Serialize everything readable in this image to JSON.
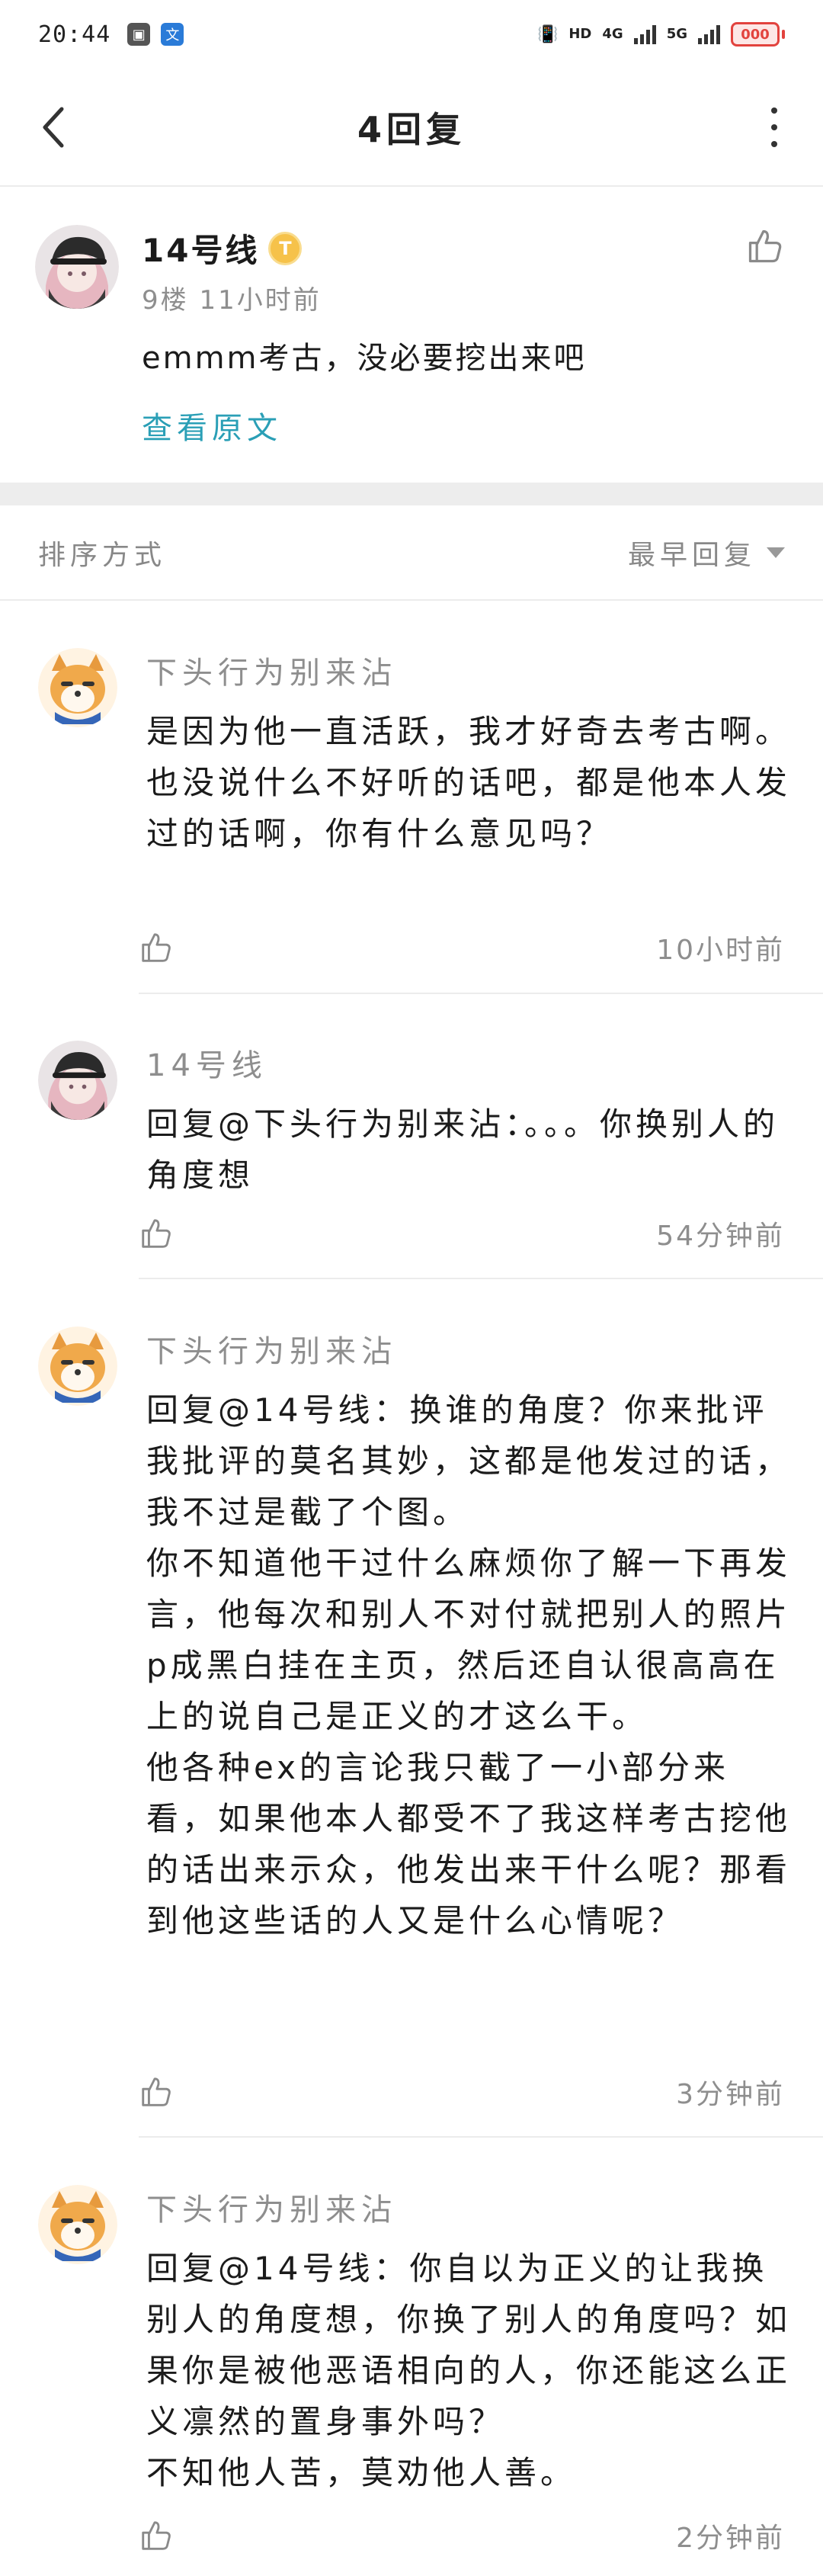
{
  "status_bar": {
    "time": "20:44",
    "network_left": "HD",
    "network_1": "4G",
    "network_2": "5G",
    "battery": "000"
  },
  "header": {
    "title": "4回复"
  },
  "post": {
    "author": "14号线",
    "level": "T",
    "meta": "9楼  11小时前",
    "text": "emmm考古，没必要挖出来吧",
    "view_original": "查看原文"
  },
  "sort": {
    "label": "排序方式",
    "selected": "最早回复"
  },
  "replies": [
    {
      "author": "下头行为别来沾",
      "text": "是因为他一直活跃，我才好奇去考古啊。也没说什么不好听的话吧，都是他本人发过的话啊，你有什么意见吗？",
      "time": "10小时前"
    },
    {
      "author": "14号线",
      "text": "回复@下头行为别来沾：。。。你换别人的角度想",
      "time": "54分钟前"
    },
    {
      "author": "下头行为别来沾",
      "text": "回复@14号线：换谁的角度？你来批评我批评的莫名其妙，这都是他发过的话，我不过是截了个图。\n你不知道他干过什么麻烦你了解一下再发言，他每次和别人不对付就把别人的照片p成黑白挂在主页，然后还自认很高高在上的说自己是正义的才这么干。\n他各种ex的言论我只截了一小部分来看，如果他本人都受不了我这样考古挖他的话出来示众，他发出来干什么呢？那看到他这些话的人又是什么心情呢？",
      "time": "3分钟前"
    },
    {
      "author": "下头行为别来沾",
      "text": "回复@14号线：你自以为正义的让我换别人的角度想，你换了别人的角度吗？如果你是被他恶语相向的人，你还能这么正义凛然的置身事外吗？\n不知他人苦，莫劝他人善。",
      "time": "2分钟前"
    }
  ]
}
